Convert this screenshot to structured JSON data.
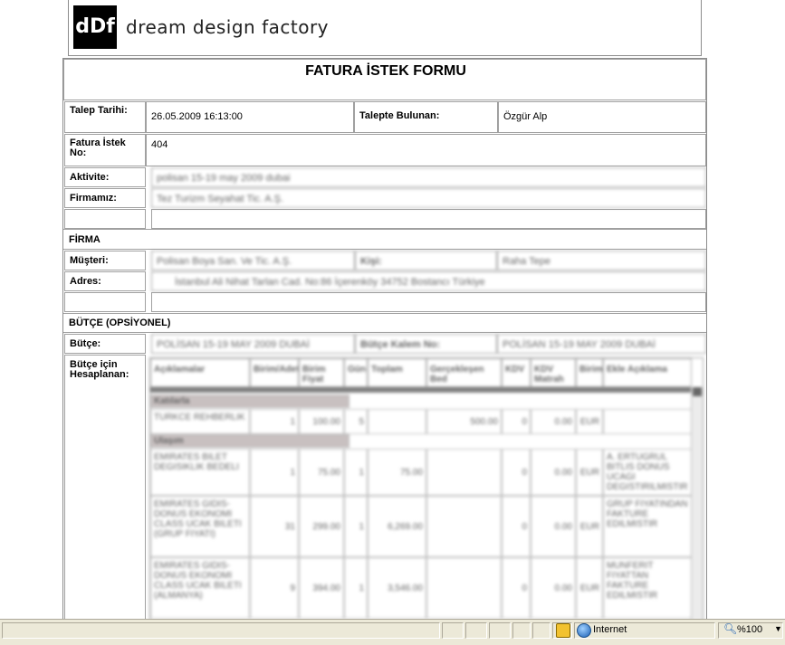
{
  "header": {
    "logo_mark": "dDf",
    "logo_text": "dream design factory"
  },
  "form": {
    "title": "FATURA İSTEK FORMU",
    "talep_tarihi_label": "Talep Tarihi:",
    "talep_tarihi_value": "26.05.2009 16:13:00",
    "talepte_bulunan_label": "Talepte Bulunan:",
    "talepte_bulunan_value": "Özgür Alp",
    "fatura_istek_no_label": "Fatura İstek No:",
    "fatura_istek_no_value": "404",
    "aktivite_label": "Aktivite:",
    "aktivite_value": "polisan 15-19 may 2009 dubai",
    "firmamiz_label": "Firmamız:",
    "firmamiz_value": "Tez Turizm Seyahat Tic. A.Ş.",
    "firma_section": "FİRMA",
    "musteri_label": "Müşteri:",
    "musteri_value": "Polisan Boya San. Ve Tic. A.Ş.",
    "musteri_kisi_label": "Kişi:",
    "musteri_kisi_value": "Raha Tepe",
    "adres_label": "Adres:",
    "adres_value": "İstanbul Ali Nihat Tarlan Cad. No:86 İçerenköy 34752 Bostancı Türkiye",
    "butce_section": "BÜTÇE (OPSİYONEL)",
    "butce_label": "Bütçe:",
    "butce_value": "POLİSAN 15-19 MAY 2009 DUBAİ",
    "butce_kalem_label": "Bütçe Kalem No:",
    "butce_kalem_value": "POLİSAN 15-19 MAY 2009 DUBAİ",
    "butce_icin_label": "Bütçe için Hesaplanan:"
  },
  "cost_table": {
    "headers": [
      "Açıklamalar",
      "Birim/Adet",
      "Birim Fiyat",
      "Gün",
      "Toplam",
      "Gerçekleşen Bed",
      "KDV",
      "KDV Matrah",
      "Birim",
      "Ekle Açıklama"
    ],
    "groups": [
      {
        "name": "Katılarla",
        "rows": [
          {
            "desc": "TURKCE REHBERLIK",
            "adet": "1",
            "fiyat": "100.00",
            "gun": "5",
            "toplam": "",
            "gercek": "500.00",
            "kdv": "0",
            "matrah": "0.00",
            "birim": "EUR",
            "aciklama": ""
          }
        ]
      },
      {
        "name": "Ulaşım",
        "rows": [
          {
            "desc": "EMIRATES BILET DEGISIKLIK BEDELI",
            "adet": "1",
            "fiyat": "75.00",
            "gun": "1",
            "toplam": "75.00",
            "gercek": "",
            "kdv": "0",
            "matrah": "0.00",
            "birim": "EUR",
            "aciklama": "A. ERTUGRUL BITLIS DONUS UCAGI DEGISTIRILMISTIR"
          },
          {
            "desc": "EMIRATES GIDIS-DONUS EKONOMI CLASS UCAK BILETI (GRUP FIYATI)",
            "adet": "31",
            "fiyat": "299.00",
            "gun": "1",
            "toplam": "6,269.00",
            "gercek": "",
            "kdv": "0",
            "matrah": "0.00",
            "birim": "EUR",
            "aciklama": "GRUP FIYATINDAN FAKTURE EDILMISTIR"
          },
          {
            "desc": "EMIRATES GIDIS-DONUS EKONOMI CLASS UCAK BILETI (ALMANYA)",
            "adet": "9",
            "fiyat": "394.00",
            "gun": "1",
            "toplam": "3,546.00",
            "gercek": "",
            "kdv": "0",
            "matrah": "0.00",
            "birim": "EUR",
            "aciklama": "MUNFERIT FIYATTAN FAKTURE EDILMISTIR"
          }
        ]
      }
    ]
  },
  "statusbar": {
    "zone": "Internet",
    "zoom": "%100"
  }
}
